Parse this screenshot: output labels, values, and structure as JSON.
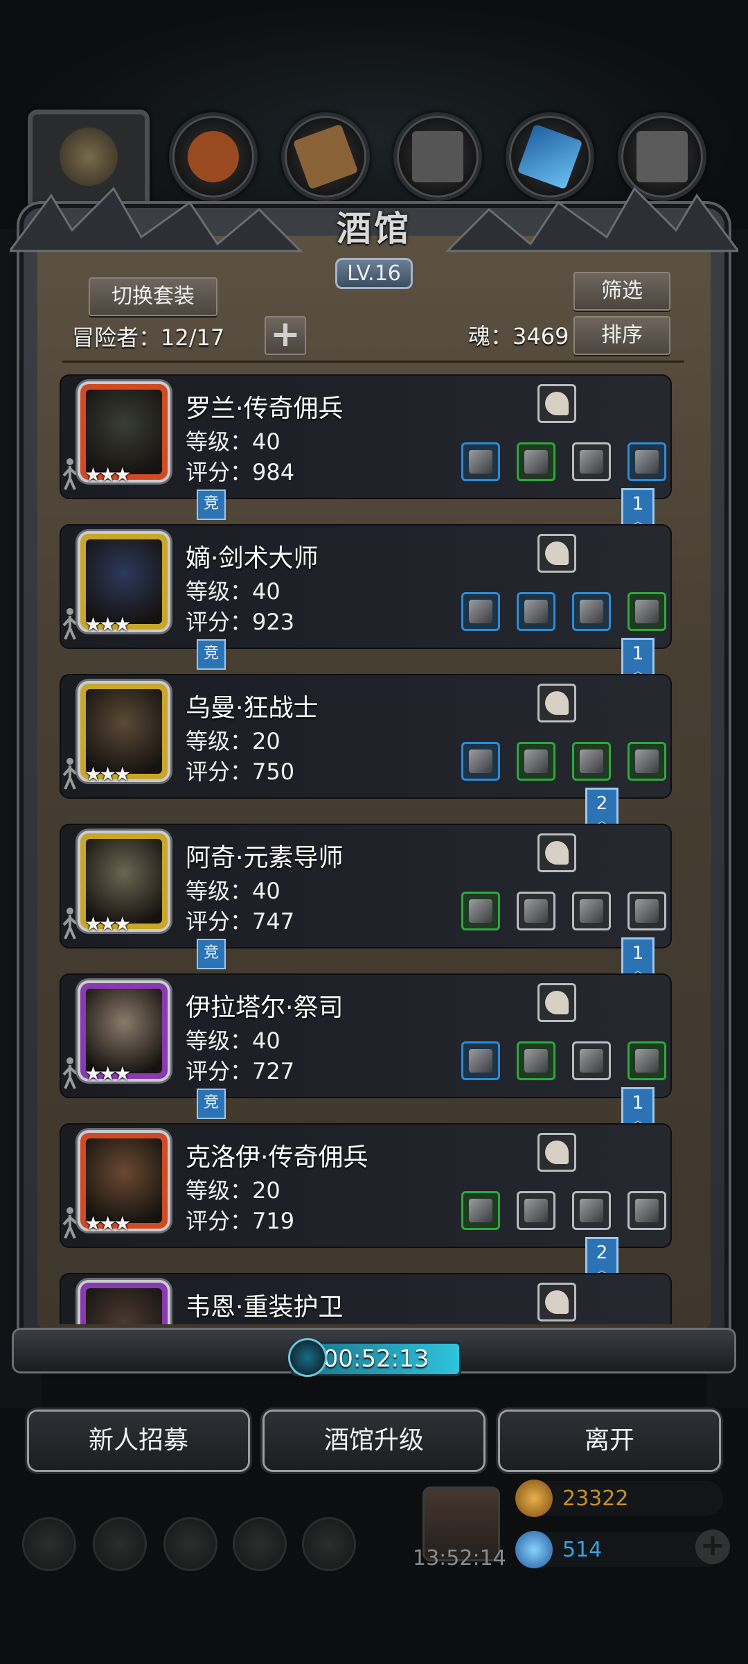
{
  "header": {
    "title": "酒馆",
    "level": "LV.16",
    "switch_set_label": "切换套装",
    "filter_label": "筛选",
    "sort_label": "排序",
    "adventurers_label": "冒险者：12/17",
    "plus_label": "+",
    "soul_label": "魂：3469"
  },
  "tabs": [
    {
      "icon": "beholder-icon",
      "color": "#6b5a3a"
    },
    {
      "icon": "leather-icon",
      "color": "#9a4a20"
    },
    {
      "icon": "wood-plank-icon",
      "color": "#8a6238"
    },
    {
      "icon": "iron-ingot-icon",
      "color": "#555555"
    },
    {
      "icon": "crystal-icon",
      "color": "#3f8fd0"
    },
    {
      "icon": "steel-ingot-icon",
      "color": "#5a5a5a"
    }
  ],
  "adventurers": [
    {
      "name": "罗兰·传奇佣兵",
      "level": "等级：40",
      "score": "评分：984",
      "frame": "#d04a24",
      "face": "#3a3d36",
      "stars": "★★★",
      "top_item": "tooth-icon",
      "items": [
        [
          "scythe-icon",
          "blue"
        ],
        [
          "armor-icon",
          "green"
        ],
        [
          "gauntlet-icon",
          "grey"
        ],
        [
          "amulet-icon",
          "blue"
        ]
      ],
      "compete": "竞",
      "ribbon": "1"
    },
    {
      "name": "嫡·剑术大师",
      "level": "等级：40",
      "score": "评分：923",
      "frame": "#c9a62a",
      "face": "#2c3a5c",
      "stars": "★★★",
      "top_item": "glove-icon",
      "items": [
        [
          "sword-icon",
          "blue"
        ],
        [
          "armor-icon",
          "blue"
        ],
        [
          "ring-icon",
          "blue"
        ],
        [
          "gauntlet-icon",
          "green"
        ]
      ],
      "compete": "竞",
      "ribbon": "1"
    },
    {
      "name": "乌曼·狂战士",
      "level": "等级：20",
      "score": "评分：750",
      "frame": "#c9a62a",
      "face": "#5a4a36",
      "stars": "★★★",
      "top_item": "glove-icon",
      "items": [
        [
          "axe-icon",
          "blue"
        ],
        [
          "armor-icon",
          "green"
        ],
        [
          "amulet-icon",
          "green"
        ],
        [
          "ring-icon",
          "green"
        ]
      ],
      "compete": "",
      "ribbon": "2"
    },
    {
      "name": "阿奇·元素导师",
      "level": "等级：40",
      "score": "评分：747",
      "frame": "#c9a62a",
      "face": "#6a6652",
      "stars": "★★★",
      "top_item": "gem-icon",
      "items": [
        [
          "staff-icon",
          "green"
        ],
        [
          "armor-icon",
          "grey"
        ],
        [
          "chest-armor-icon",
          "grey"
        ],
        [
          "gauntlet-icon",
          "grey"
        ]
      ],
      "compete": "竞",
      "ribbon": "1"
    },
    {
      "name": "伊拉塔尔·祭司",
      "level": "等级：40",
      "score": "评分：727",
      "frame": "#8a3ab0",
      "face": "#8a7a6a",
      "stars": "★★★",
      "top_item": "dagger-icon",
      "items": [
        [
          "hammer-icon",
          "blue"
        ],
        [
          "armor-icon",
          "green"
        ],
        [
          "chest-armor-icon",
          "grey"
        ],
        [
          "chest-armor-icon",
          "green"
        ]
      ],
      "compete": "竞",
      "ribbon": "1"
    },
    {
      "name": "克洛伊·传奇佣兵",
      "level": "等级：20",
      "score": "评分：719",
      "frame": "#d04a24",
      "face": "#6a4a32",
      "stars": "★★★",
      "top_item": "glove-icon",
      "items": [
        [
          "scythe-icon",
          "green"
        ],
        [
          "leather-armor-icon",
          "grey"
        ],
        [
          "amulet-icon",
          "grey"
        ],
        [
          "bracer-icon",
          "grey"
        ]
      ],
      "compete": "",
      "ribbon": "2"
    },
    {
      "name": "韦恩·重装护卫",
      "level": "",
      "score": "",
      "frame": "#8a3ab0",
      "face": "#4a3a30",
      "stars": "",
      "top_item": "crystal-icon",
      "items": [],
      "compete": "",
      "ribbon": ""
    }
  ],
  "timer": "00:52:13",
  "actions": {
    "recruit": "新人招募",
    "upgrade": "酒馆升级",
    "leave": "离开"
  },
  "footer": {
    "gift_timer": "13:52:14",
    "gold": "23322",
    "gems": "514",
    "gold_color": "#c8902a",
    "gem_color": "#3aa0e0"
  }
}
